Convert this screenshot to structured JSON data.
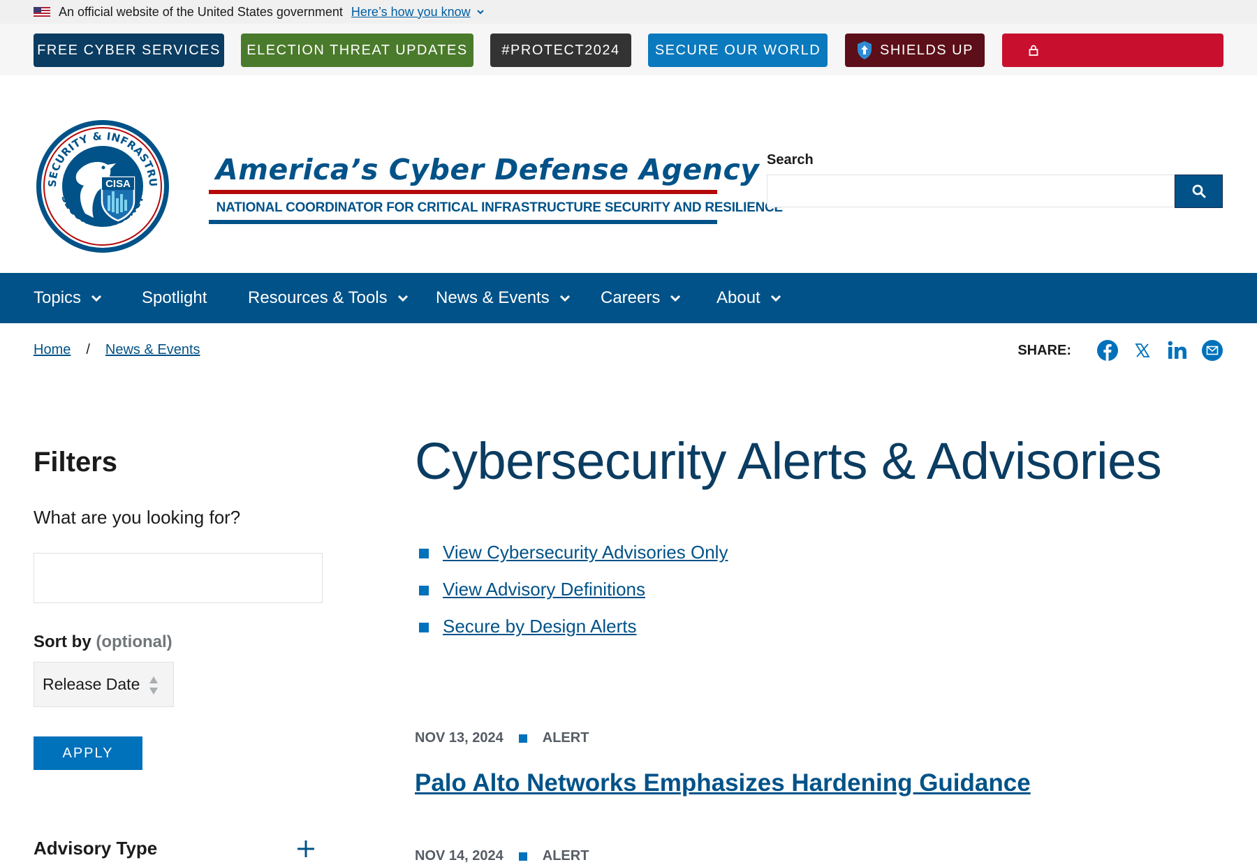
{
  "gov_banner": {
    "text": "An official website of the United States government",
    "link": "Here’s how you know"
  },
  "alert_buttons": [
    {
      "label": "FREE CYBER SERVICES",
      "color": "#0b3c61"
    },
    {
      "label": "ELECTION THREAT UPDATES",
      "color": "#4a7a2b"
    },
    {
      "label": "#PROTECT2024",
      "color": "#333333"
    },
    {
      "label": "SECURE OUR WORLD",
      "color": "#0a79be"
    },
    {
      "label": "SHIELDS UP",
      "color": "#5c0f18"
    },
    {
      "label": "",
      "color": "#c8102e",
      "icon": "lock-icon"
    }
  ],
  "header": {
    "logo_text": "CISA",
    "logo_ring_text": "CYBERSECURITY & INFRASTRUCTURE SECURITY AGENCY",
    "tagline_title": "America’s Cyber Defense Agency",
    "tagline_sub": "NATIONAL COORDINATOR FOR CRITICAL INFRASTRUCTURE SECURITY AND RESILIENCE",
    "search_label": "Search",
    "search_value": "",
    "search_icon": "search-icon"
  },
  "nav": {
    "items": [
      {
        "label": "Topics",
        "has_dropdown": true
      },
      {
        "label": "Spotlight",
        "has_dropdown": false
      },
      {
        "label": "Resources & Tools",
        "has_dropdown": true
      },
      {
        "label": "News & Events",
        "has_dropdown": true
      },
      {
        "label": "Careers",
        "has_dropdown": true
      },
      {
        "label": "About",
        "has_dropdown": true
      }
    ]
  },
  "breadcrumb": [
    "Home",
    "News & Events"
  ],
  "share": {
    "label": "SHARE:",
    "icons": [
      "facebook-icon",
      "x-icon",
      "linkedin-icon",
      "email-icon"
    ]
  },
  "filters": {
    "title": "Filters",
    "query_label": "What are you looking for?",
    "query_value": "",
    "sort_label": "Sort by",
    "sort_optional": "(optional)",
    "sort_value": "Release Date",
    "apply_label": "APPLY",
    "advisory_type_label": "Advisory Type"
  },
  "main": {
    "title": "Cybersecurity Alerts & Advisories",
    "links": [
      "View Cybersecurity Advisories Only",
      "View Advisory Definitions",
      "Secure by Design Alerts"
    ],
    "articles": [
      {
        "date": "NOV 13, 2024",
        "type": "ALERT",
        "title": "Palo Alto Networks Emphasizes Hardening Guidance"
      },
      {
        "date": "NOV 14, 2024",
        "type": "ALERT",
        "title": ""
      }
    ]
  },
  "colors": {
    "primary_blue": "#005288",
    "accent_blue": "#0071bb",
    "title_blue": "#0b3c61"
  }
}
